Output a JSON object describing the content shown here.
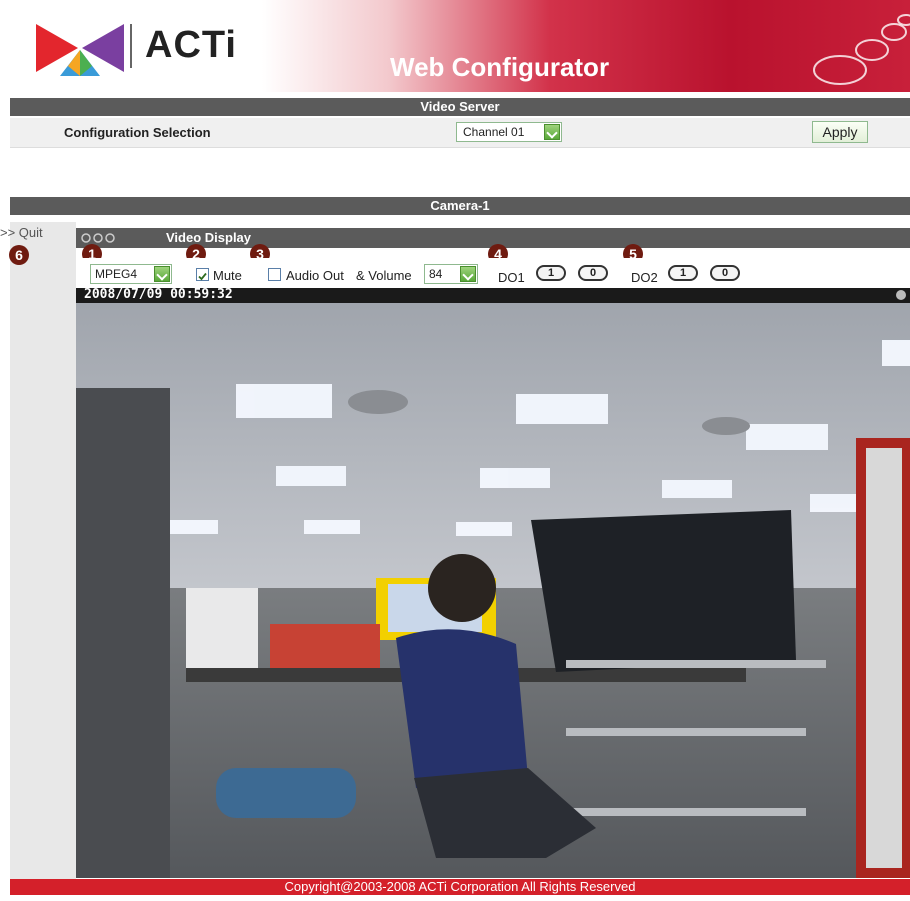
{
  "header": {
    "brand": "ACTi",
    "title": "Web Configurator"
  },
  "video_server": {
    "bar_title": "Video Server",
    "config_label": "Configuration Selection",
    "channel_value": "Channel 01",
    "apply_label": "Apply"
  },
  "camera": {
    "bar_title": "Camera-1"
  },
  "left": {
    "quit_label": ">> Quit"
  },
  "video_display": {
    "title": "Video Display",
    "codec_value": "MPEG4",
    "mute_label": "Mute",
    "mute_checked": true,
    "audio_out_label": "Audio Out",
    "volume_label": "& Volume",
    "volume_value": "84",
    "do1_label": "DO1",
    "do2_label": "DO2",
    "pill_one": "1",
    "pill_zero": "0",
    "timestamp": "2008/07/09 00:59:32"
  },
  "markers": [
    "1",
    "2",
    "3",
    "4",
    "5",
    "6"
  ],
  "footer": {
    "copyright": "Copyright@2003-2008 ACTi Corporation All Rights Reserved"
  },
  "colors": {
    "brand_red": "#c8203a",
    "bar_gray": "#5b5b5b",
    "marker_brown": "#6f1b10",
    "accent_green": "#5aa83a"
  }
}
